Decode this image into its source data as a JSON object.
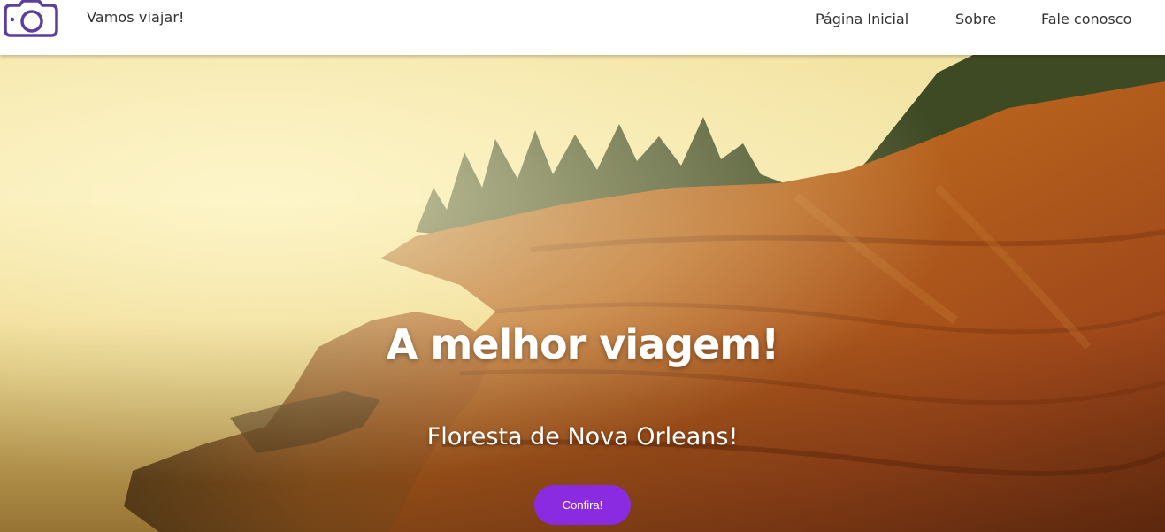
{
  "header": {
    "brand": "Vamos viajar!",
    "logo_icon": "camera-icon",
    "nav": [
      {
        "label": "Página Inicial"
      },
      {
        "label": "Sobre"
      },
      {
        "label": "Fale conosco"
      }
    ]
  },
  "hero": {
    "title": "A melhor viagem!",
    "subtitle": "Floresta de Nova Orleans!",
    "button_label": "Confira!"
  },
  "colors": {
    "accent": "#8a2be2",
    "logo": "#5b3fa0",
    "nav_text": "#333333"
  }
}
